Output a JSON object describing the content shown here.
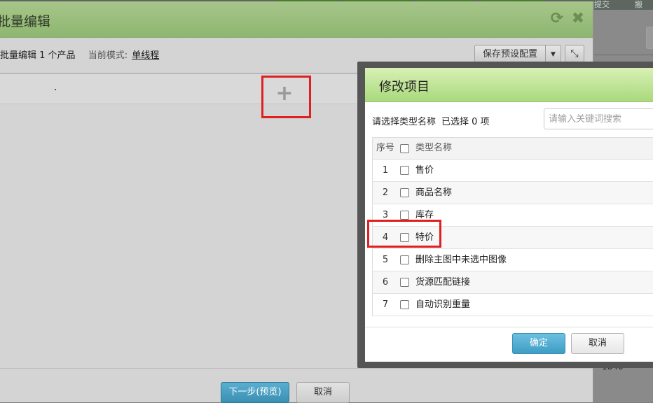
{
  "background": {
    "top_tabs": [
      "提交",
      "搬"
    ],
    "number_text": "1846"
  },
  "main_dialog": {
    "title": "批量编辑",
    "info": {
      "prefix": "批量编辑 1 个产品",
      "mode_label": "当前模式:",
      "mode_value": "单线程"
    },
    "save_preset_label": "保存预设配置",
    "add_icon": "plus-icon",
    "next_label": "下一步(预览)",
    "cancel_label": "取消",
    "header_colors": {
      "accent": "#8eb671"
    }
  },
  "modal": {
    "title": "修改项目",
    "select_prompt": "请选择类型名称",
    "selected_count": "已选择 0 项",
    "search_placeholder": "请输入关键词搜索",
    "columns": {
      "index": "序号",
      "name": "类型名称"
    },
    "rows": [
      {
        "index": "1",
        "name": "售价",
        "checked": false
      },
      {
        "index": "2",
        "name": "商品名称",
        "checked": false
      },
      {
        "index": "3",
        "name": "库存",
        "checked": false
      },
      {
        "index": "4",
        "name": "特价",
        "checked": false
      },
      {
        "index": "5",
        "name": "删除主图中未选中图像",
        "checked": false
      },
      {
        "index": "6",
        "name": "货源匹配链接",
        "checked": false
      },
      {
        "index": "7",
        "name": "自动识别重量",
        "checked": false
      }
    ],
    "ok_label": "确定",
    "cancel_label": "取消",
    "header_color": "#a9d97c",
    "highlight_color": "#e02020"
  }
}
